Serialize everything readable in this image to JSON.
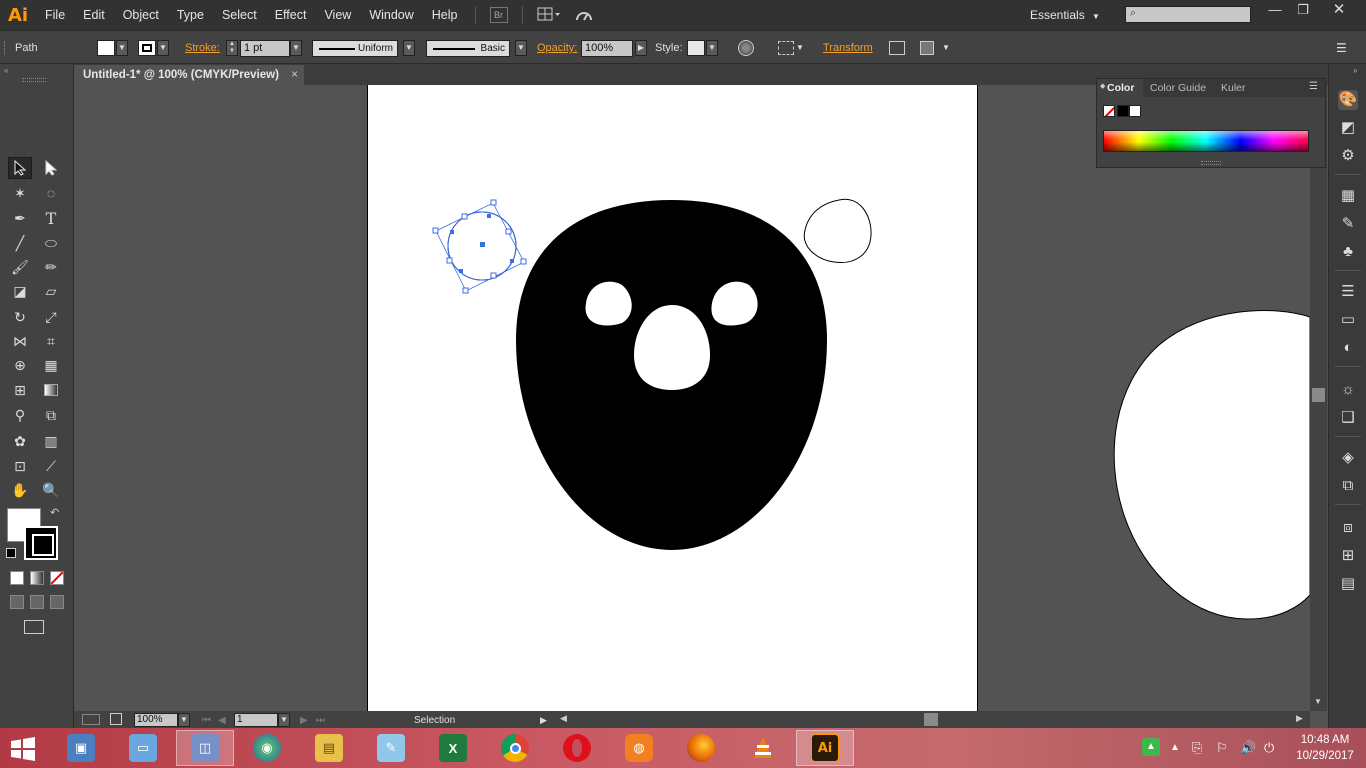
{
  "app": {
    "logo": "Ai",
    "menu": [
      "File",
      "Edit",
      "Object",
      "Type",
      "Select",
      "Effect",
      "View",
      "Window",
      "Help"
    ],
    "bridge_label": "Br",
    "workspace": "Essentials",
    "window_controls": [
      "minimize-icon",
      "restore-icon",
      "close-icon"
    ]
  },
  "control_bar": {
    "selection_type": "Path",
    "stroke_label": "Stroke:",
    "stroke_weight": "1 pt",
    "profile": "Uniform",
    "brush": "Basic",
    "opacity_label": "Opacity:",
    "opacity_value": "100%",
    "style_label": "Style:",
    "transform_label": "Transform",
    "fill_color": "#ffffff",
    "stroke_color": "#000000"
  },
  "document": {
    "tab_title": "Untitled-1* @ 100% (CMYK/Preview)",
    "close": "×"
  },
  "tools": {
    "fill_color": "#ffffff",
    "stroke_color": "#000000"
  },
  "status_bar": {
    "zoom": "100%",
    "artboard_number": "1",
    "current_tool": "Selection"
  },
  "color_panel": {
    "tabs": [
      "Color",
      "Color Guide",
      "Kuler"
    ],
    "active_tab": "Color"
  },
  "canvas": {
    "artwork": [
      "head-shape",
      "left-eye",
      "right-eye",
      "nose",
      "selected-ear-circle",
      "ear-outline",
      "large-white-shape"
    ],
    "selection_color": "#3a6ee8"
  },
  "taskbar": {
    "apps": [
      "remote-desktop-icon",
      "remote-app-icon",
      "control-panel-icon",
      "network-globe-icon",
      "file-explorer-icon",
      "notepad-icon",
      "excel-icon",
      "chrome-icon",
      "opera-icon",
      "uc-browser-icon",
      "firefox-icon",
      "vlc-icon",
      "illustrator-icon"
    ],
    "active_app": "Ai",
    "time": "10:48 AM",
    "date": "10/29/2017"
  }
}
